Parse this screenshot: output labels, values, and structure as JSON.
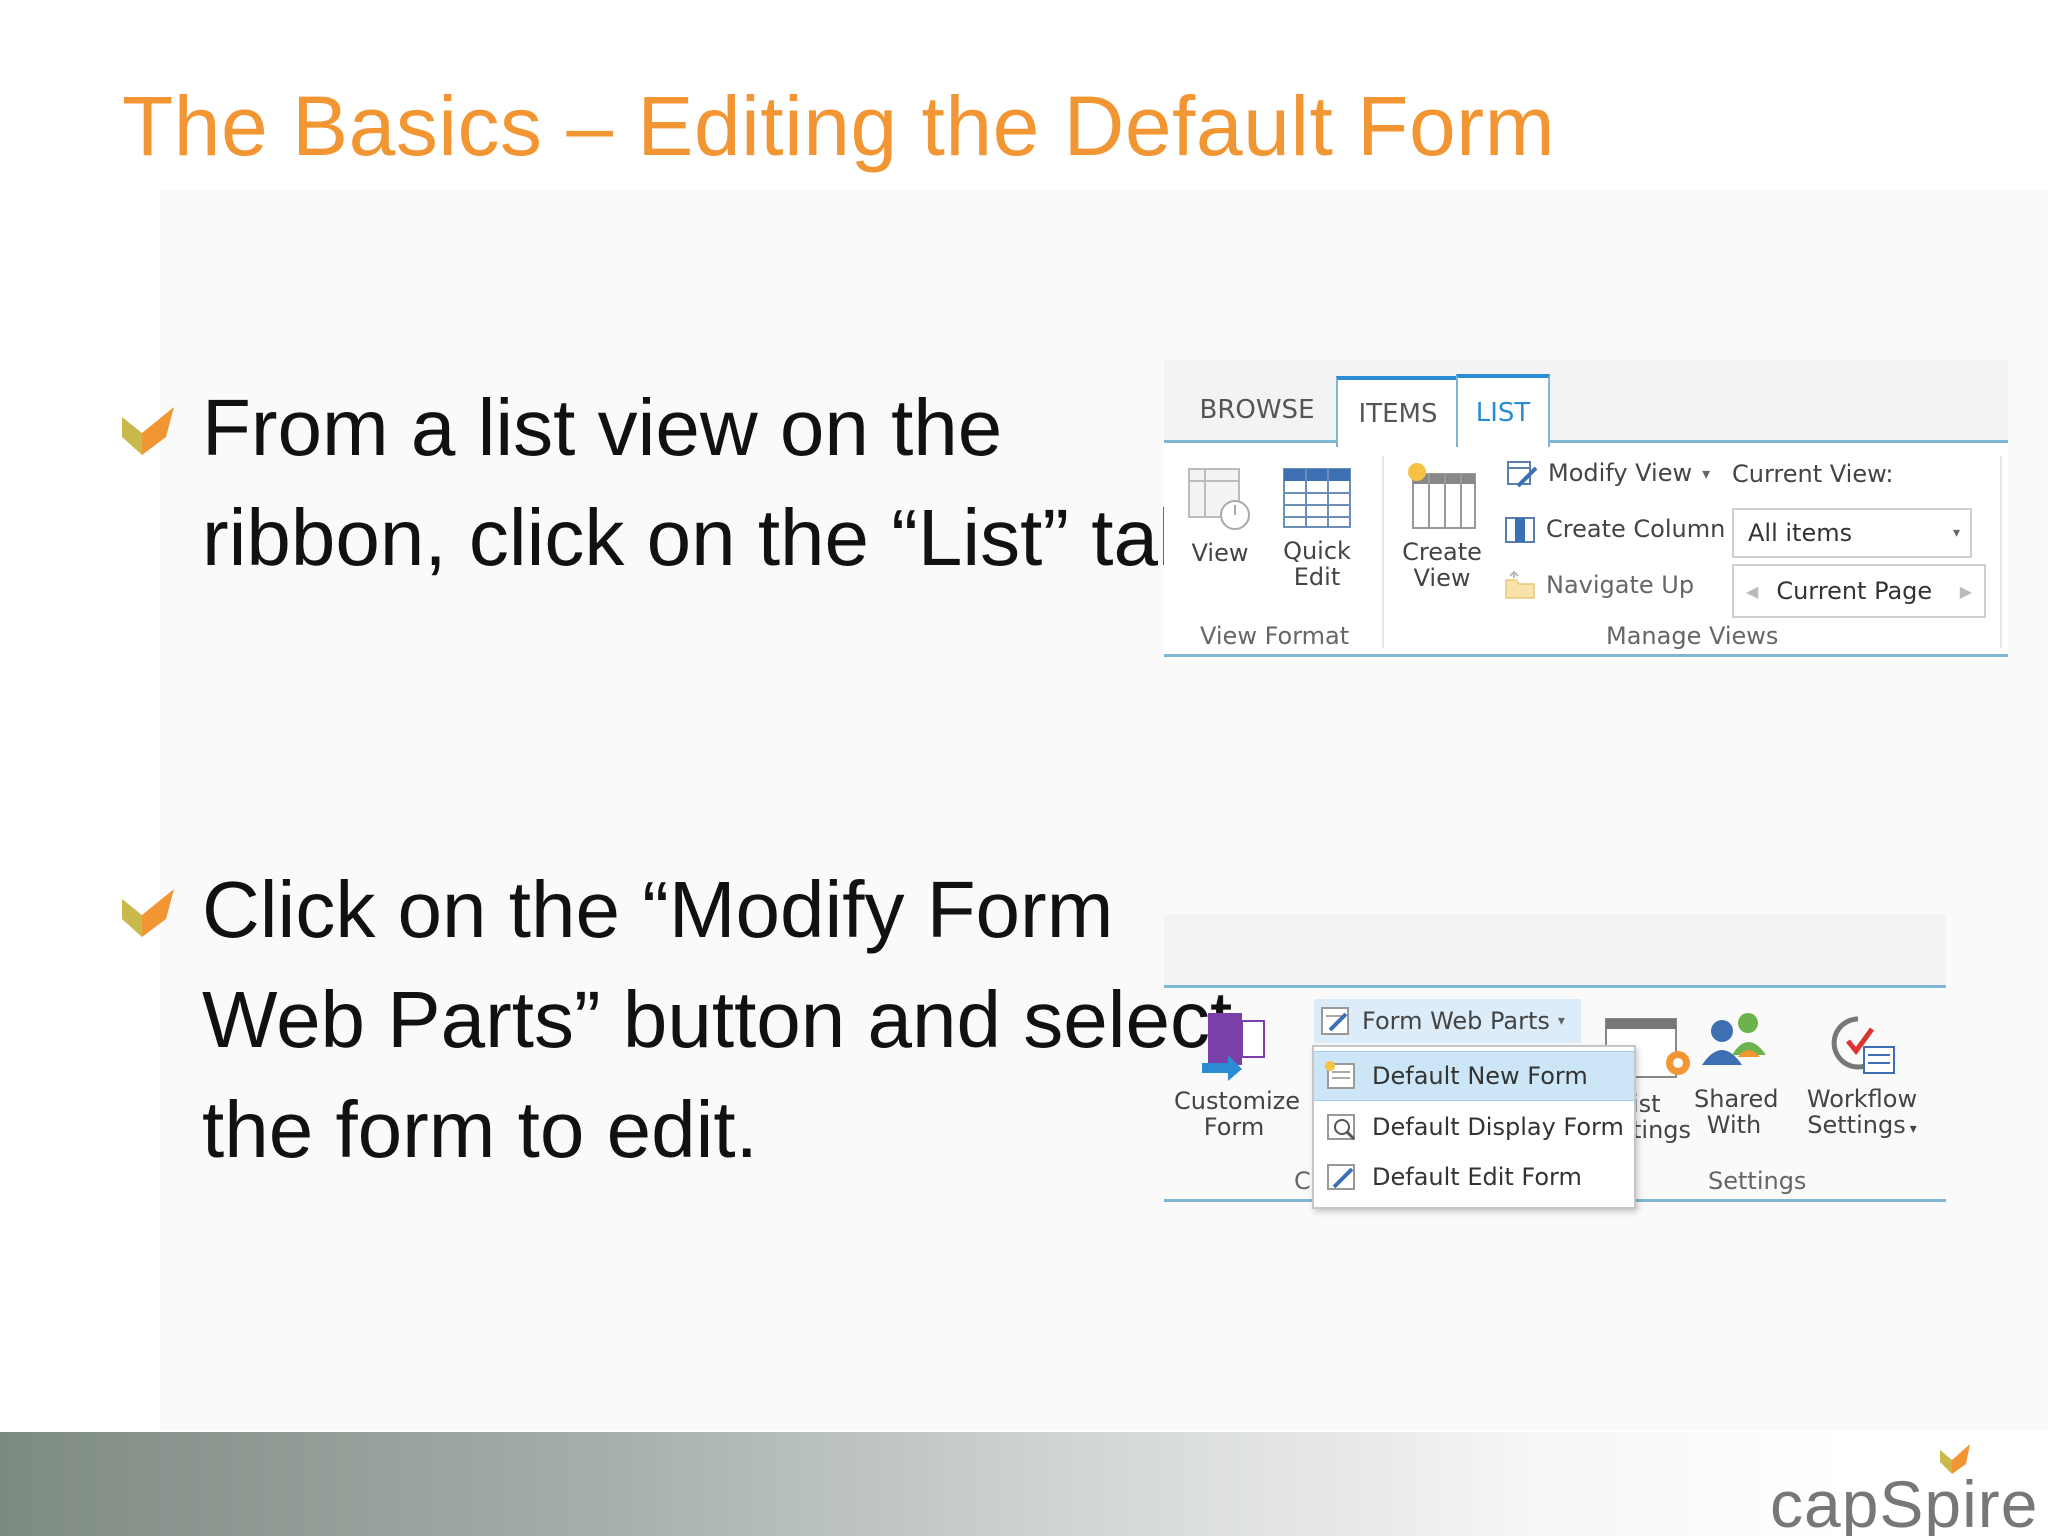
{
  "slide": {
    "title": "The Basics – Editing the Default Form",
    "bullets": [
      {
        "text": "From a list view on the ribbon, click on the “List” tab"
      },
      {
        "text": "Click on the “Modify Form Web Parts” button and select the form to edit."
      }
    ]
  },
  "ribbon1": {
    "tabs": [
      "BROWSE",
      "ITEMS",
      "LIST"
    ],
    "selected_tab": "LIST",
    "view_format": {
      "view_label": "View",
      "quick_edit_label_1": "Quick",
      "quick_edit_label_2": "Edit",
      "group_label": "View Format"
    },
    "manage_views": {
      "create_view_label_1": "Create",
      "create_view_label_2": "View",
      "modify_view_label": "Modify View",
      "create_column_label": "Create Column",
      "navigate_up_label": "Navigate Up",
      "current_view_label": "Current View:",
      "current_view_value": "All items",
      "current_page_label": "Current Page",
      "group_label": "Manage Views"
    }
  },
  "ribbon2": {
    "customize_form_label_1": "Customize",
    "customize_form_label_2": "Form",
    "customize_group_partial": "C",
    "form_web_parts_label": "Form Web Parts",
    "menu_items": [
      "Default New Form",
      "Default Display Form",
      "Default Edit Form"
    ],
    "list_settings_partial_1": "ist",
    "list_settings_partial_2": "tings",
    "shared_with_label_1": "Shared",
    "shared_with_label_2": "With",
    "workflow_settings_label_1": "Workflow",
    "workflow_settings_label_2": "Settings",
    "settings_group_label": "Settings"
  },
  "footer": {
    "logo_text": "capSpire"
  },
  "colors": {
    "title": "#f29634",
    "ribbon_accent": "#2a8dd4",
    "ribbon_border": "#7fb6d6",
    "menu_highlight": "#cde6f7"
  },
  "icons": {
    "bullet": "orange-checkmark-icon",
    "view": "view-icon",
    "quick_edit": "grid-icon",
    "create_view": "create-view-icon",
    "modify_view": "modify-view-icon",
    "create_column": "create-column-icon",
    "navigate_up": "folder-up-icon",
    "customize_form": "infopath-icon",
    "form_web_parts": "form-web-parts-icon",
    "shared_with": "users-icon",
    "workflow_settings": "workflow-icon"
  }
}
